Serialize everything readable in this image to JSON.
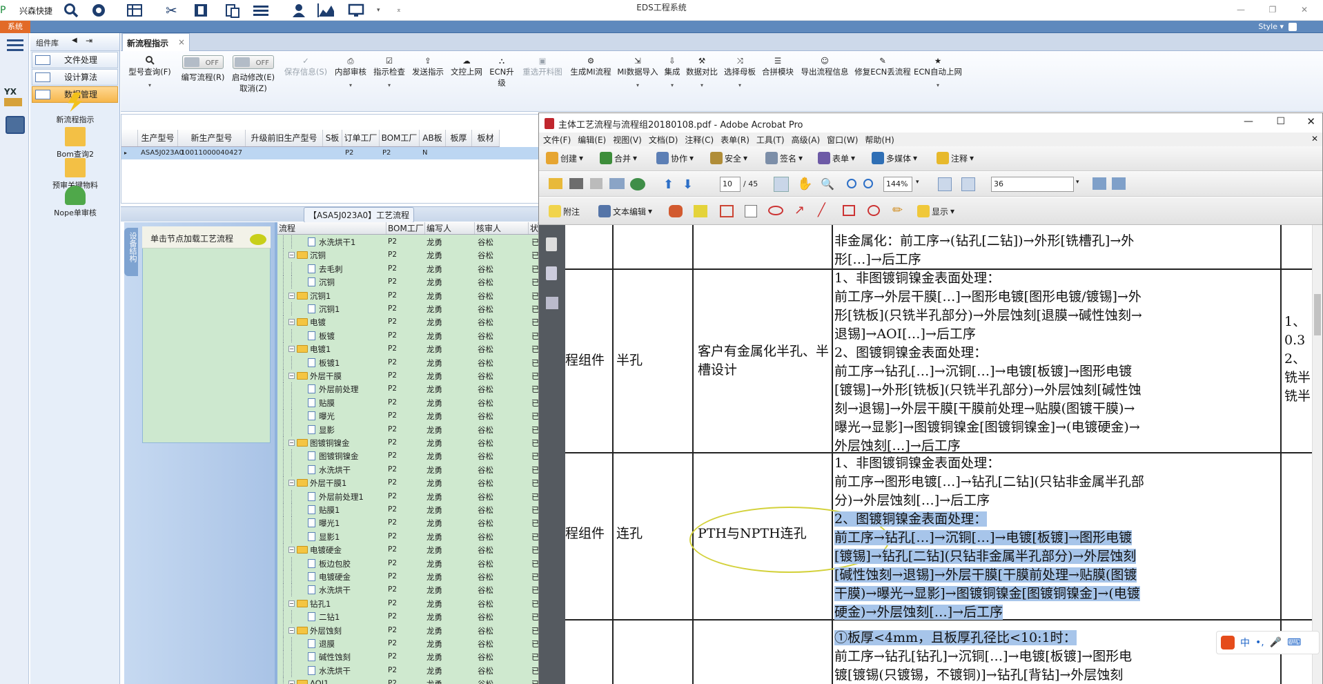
{
  "app": {
    "name": "兴森快捷",
    "title": "EDS工程系统",
    "sys_tab": "系统",
    "style_label": "Style"
  },
  "sidebar": {
    "header": "组件库",
    "items": [
      {
        "label": "文件处理"
      },
      {
        "label": "设计算法"
      },
      {
        "label": "数据管理"
      }
    ],
    "tools": [
      {
        "label": "新流程指示"
      },
      {
        "label": "Bom查询2"
      },
      {
        "label": "预审关键物料"
      },
      {
        "label": "Nope单审核"
      }
    ]
  },
  "tab": {
    "label": "新流程指示"
  },
  "ribbon": {
    "buttons": [
      {
        "label": "型号查询(F)",
        "icon": "search-icon"
      },
      {
        "label": "编写流程(R)",
        "toggle": "OFF"
      },
      {
        "label": "启动修改(E)",
        "label2": "取消(Z)",
        "toggle": "OFF"
      },
      {
        "label": "保存信息(S)",
        "disabled": true
      },
      {
        "label": "内部审核"
      },
      {
        "label": "指示检查"
      },
      {
        "label": "发送指示"
      },
      {
        "label": "文控上网"
      },
      {
        "label": "ECN升级"
      },
      {
        "label": "重选开料图",
        "disabled": true
      },
      {
        "label": "生成MI流程"
      },
      {
        "label": "MI数据导入"
      },
      {
        "label": "集成"
      },
      {
        "label": "数据对比"
      },
      {
        "label": "选择母板"
      },
      {
        "label": "合拼模块"
      },
      {
        "label": "导出流程信息"
      },
      {
        "label": "修复ECN丢流程"
      },
      {
        "label": "ECN自动上网"
      }
    ]
  },
  "grid": {
    "headers": [
      "生产型号",
      "新生产型号",
      "升级前旧生产型号",
      "S板",
      "订单工厂",
      "BOM工厂",
      "AB板",
      "板厚",
      "板材"
    ],
    "row": [
      "ASA5J023A0",
      "10011000040427",
      "",
      "",
      "P2",
      "P2",
      "N",
      "",
      ""
    ]
  },
  "process": {
    "title": "【ASA5J023A0】工艺流程",
    "vtab": "设备结构",
    "load_hint": "单击节点加载工艺流程",
    "columns": [
      "流程",
      "BOM工厂",
      "编写人",
      "核审人",
      "状"
    ],
    "rows": [
      {
        "name": "水洗烘干1",
        "lvl": 2
      },
      {
        "name": "沉铜",
        "lvl": 1
      },
      {
        "name": "去毛刺",
        "lvl": 2
      },
      {
        "name": "沉铜",
        "lvl": 2
      },
      {
        "name": "沉铜1",
        "lvl": 1
      },
      {
        "name": "沉铜1",
        "lvl": 2
      },
      {
        "name": "电镀",
        "lvl": 1
      },
      {
        "name": "板镀",
        "lvl": 2
      },
      {
        "name": "电镀1",
        "lvl": 1
      },
      {
        "name": "板镀1",
        "lvl": 2
      },
      {
        "name": "外层干膜",
        "lvl": 1
      },
      {
        "name": "外层前处理",
        "lvl": 2
      },
      {
        "name": "贴膜",
        "lvl": 2
      },
      {
        "name": "曝光",
        "lvl": 2
      },
      {
        "name": "显影",
        "lvl": 2
      },
      {
        "name": "图镀铜镍金",
        "lvl": 1
      },
      {
        "name": "图镀铜镍金",
        "lvl": 2
      },
      {
        "name": "水洗烘干",
        "lvl": 2
      },
      {
        "name": "外层干膜1",
        "lvl": 1
      },
      {
        "name": "外层前处理1",
        "lvl": 2
      },
      {
        "name": "贴膜1",
        "lvl": 2
      },
      {
        "name": "曝光1",
        "lvl": 2
      },
      {
        "name": "显影1",
        "lvl": 2
      },
      {
        "name": "电镀硬金",
        "lvl": 1
      },
      {
        "name": "板边包胶",
        "lvl": 2
      },
      {
        "name": "电镀硬金",
        "lvl": 2
      },
      {
        "name": "水洗烘干",
        "lvl": 2
      },
      {
        "name": "钻孔1",
        "lvl": 1
      },
      {
        "name": "二钻1",
        "lvl": 2
      },
      {
        "name": "外层蚀刻",
        "lvl": 1
      },
      {
        "name": "退膜",
        "lvl": 2
      },
      {
        "name": "碱性蚀刻",
        "lvl": 2
      },
      {
        "name": "水洗烘干",
        "lvl": 2
      },
      {
        "name": "AOI1",
        "lvl": 1
      }
    ],
    "col_values": {
      "factory": "P2",
      "writer": "龙勇",
      "reviewer": "谷松",
      "status": "已"
    }
  },
  "acrobat": {
    "title": "主体工艺流程与流程组20180108.pdf - Adobe Acrobat Pro",
    "menu": [
      "文件(F)",
      "编辑(E)",
      "视图(V)",
      "文档(D)",
      "注释(C)",
      "表单(R)",
      "工具(T)",
      "高级(A)",
      "窗口(W)",
      "帮助(H)"
    ],
    "toolbar1": [
      "创建",
      "合并",
      "协作",
      "安全",
      "签名",
      "表单",
      "多媒体",
      "注释"
    ],
    "page_current": "10",
    "page_total": "/ 45",
    "zoom": "144%",
    "find": "36",
    "toolbar3": [
      "附注",
      "文本编辑",
      "显示"
    ],
    "doc": {
      "r0": {
        "c4": [
          "非金属化：前工序→(钻孔[二钻])→外形[铣槽孔]→外",
          "形[…]→后工序"
        ]
      },
      "r1": {
        "c1": "程组件",
        "c2": "半孔",
        "c3": [
          "客户有金属化半孔、半",
          "槽设计"
        ],
        "c4": [
          "1、非图镀铜镍金表面处理：",
          "前工序→外层干膜[…]→图形电镀[图形电镀/镀锡]→外",
          "形[铣板](只铣半孔部分)→外层蚀刻[退膜→碱性蚀刻→",
          "退锡]→AOI[…]→后工序",
          "2、图镀铜镍金表面处理：",
          "前工序→钻孔[…]→沉铜[…]→电镀[板镀]→图形电镀",
          "[镀锡]→外形[铣板](只铣半孔部分)→外层蚀刻[碱性蚀",
          "刻→退锡]→外层干膜[干膜前处理→贴膜(图镀干膜)→",
          "曝光→显影]→图镀铜镍金[图镀铜镍金]→(电镀硬金)→",
          "外层蚀刻[…]→后工序"
        ],
        "c5": [
          "1、",
          "0.3",
          "2、",
          "铣半",
          "铣半"
        ]
      },
      "r2": {
        "c1": "程组件",
        "c2": "连孔",
        "c3": "PTH与NPTH连孔",
        "c4": [
          "1、非图镀铜镍金表面处理：",
          "前工序→图形电镀[…]→钻孔[二钻](只钻非金属半孔部",
          "分)→外层蚀刻[…]→后工序"
        ],
        "c4h": [
          "2、图镀铜镍金表面处理：",
          "前工序→钻孔[…]→沉铜[…]→电镀[板镀]→图形电镀",
          "[镀锡]→钻孔[二钻](只钻非金属半孔部分)→外层蚀刻",
          "[碱性蚀刻→退锡]→外层干膜[干膜前处理→贴膜(图镀",
          "干膜)→曝光→显影]→图镀铜镍金[图镀铜镍金]→(电镀",
          "硬金)→外层蚀刻[…]→后工序"
        ]
      },
      "r3": {
        "c4h": [
          "①板厚<4mm，且板厚孔径比<10:1时："
        ],
        "c4": [
          "前工序→钻孔[钻孔]→沉铜[…]→电镀[板镀]→图形电",
          "镀[镀锡(只镀锡，不镀铜)]→钻孔[背钻]→外层蚀刻"
        ]
      }
    }
  },
  "ime": {
    "label": "中"
  }
}
